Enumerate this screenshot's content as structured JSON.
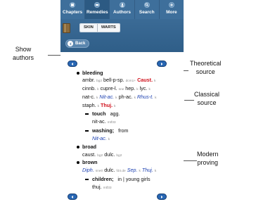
{
  "navbar": {
    "items": [
      {
        "label": "Chapters",
        "icon": "book-icon"
      },
      {
        "label": "Remedies",
        "icon": "pill-icon"
      },
      {
        "label": "Authors",
        "icon": "person-icon"
      },
      {
        "label": "Search",
        "icon": "search-icon"
      },
      {
        "label": "More",
        "icon": "plus-icon"
      }
    ]
  },
  "subbar": {
    "toggle": [
      "SKIN",
      "WARTS"
    ],
    "back_label": "Back"
  },
  "rubrics": {
    "bleeding": {
      "title": "bleeding",
      "lines": [
        {
          "rem": "ambr.",
          "src": "bg2",
          "rem2": "bell-p-sp.",
          "src2": "dcm1+",
          "red": "Caust.",
          "src3": "k"
        },
        {
          "rem": "cinnb.",
          "src": "k",
          "rem2": "cupre-l.",
          "src2": "sne",
          "rem3": "hep.",
          "src3": "k",
          "rem4": "lyc.",
          "src4": "k"
        },
        {
          "rem": "nat-c.",
          "src": "k",
          "blue": "Nit-ac.",
          "src2": "k",
          "rem2": "ph-ac.",
          "src3": "k",
          "blue2": "Rhus-t.",
          "src4": "k"
        },
        {
          "rem": "staph.",
          "src": "k",
          "red": "Thuj.",
          "src2": "k"
        }
      ]
    },
    "touch": {
      "title": "touch",
      "suffix": "agg.",
      "rem": "nit-ac.",
      "src": "mtf33"
    },
    "washing": {
      "title": "washing;",
      "suffix": "from",
      "blue": "Nit-ac.",
      "src": "k"
    },
    "broad": {
      "title": "broad",
      "rem": "caust.",
      "src": "bg2",
      "rem2": "dulc.",
      "src2": "bg2"
    },
    "brown": {
      "title": "brown",
      "blue": "Diph.",
      "src": "sne0",
      "rem": "dulc.",
      "src2": "fd4.de",
      "blue2": "Sep.",
      "src3": "k",
      "blue3": "Thuj.",
      "src4": "k"
    },
    "children": {
      "title": "children;",
      "suffix": "in | young girls",
      "rem": "thuj.",
      "src": "mtf33"
    }
  },
  "callouts": {
    "show_authors": [
      "Show",
      "authors"
    ],
    "theoretical": [
      "Theoretical",
      "source"
    ],
    "classical": [
      "Classical",
      "source"
    ],
    "modern": [
      "Modern",
      "proving"
    ]
  },
  "colors": {
    "navbar": "#3e6f9b",
    "remedy_highlight_red": "#d0101b",
    "remedy_highlight_blue": "#1b3fb0",
    "pager_pill": "#2866b3"
  }
}
